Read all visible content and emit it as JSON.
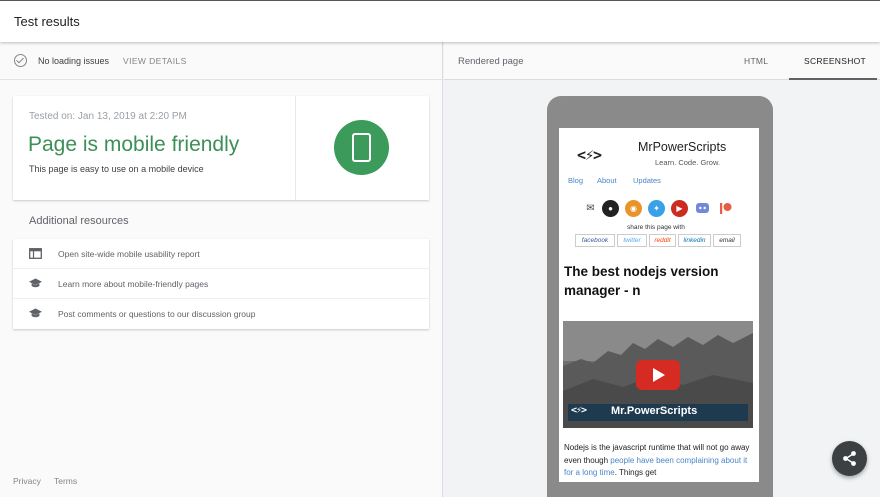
{
  "header": {
    "title": "Test results"
  },
  "status": {
    "text": "No loading issues",
    "view_details": "VIEW DETAILS"
  },
  "result": {
    "tested_on": "Tested on: Jan 13, 2019 at 2:20 PM",
    "headline": "Page is mobile friendly",
    "subline": "This page is easy to use on a mobile device",
    "accent_color": "#3c8f56"
  },
  "resources": {
    "heading": "Additional resources",
    "items": [
      {
        "label": "Open site-wide mobile usability report",
        "icon": "web-window-icon"
      },
      {
        "label": "Learn more about mobile-friendly pages",
        "icon": "school-icon"
      },
      {
        "label": "Post comments or questions to our discussion group",
        "icon": "school-icon"
      }
    ]
  },
  "footer": {
    "privacy": "Privacy",
    "terms": "Terms"
  },
  "preview": {
    "label": "Rendered page",
    "tabs": [
      {
        "label": "HTML",
        "active": false
      },
      {
        "label": "SCREENSHOT",
        "active": true
      }
    ]
  },
  "site": {
    "logo": "<⚡>",
    "brand": "MrPowerScripts",
    "tagline": "Learn. Code. Grow.",
    "nav": [
      "Blog",
      "About",
      "Updates"
    ],
    "social": [
      {
        "icon": "email-icon",
        "color": "#444444"
      },
      {
        "icon": "github-icon",
        "color": "#222222"
      },
      {
        "icon": "rss-icon",
        "color": "#e7942a"
      },
      {
        "icon": "twitter-icon",
        "color": "#3aa0e8"
      },
      {
        "icon": "youtube-icon",
        "color": "#cc2b22"
      },
      {
        "icon": "discord-icon",
        "color": "#7289da"
      },
      {
        "icon": "patreon-icon",
        "color": "#e85b46"
      }
    ],
    "share_label": "share this page with",
    "share_buttons": [
      {
        "label": "facebook",
        "color": "#3b5998"
      },
      {
        "label": "twitter",
        "color": "#55acee"
      },
      {
        "label": "reddit",
        "color": "#ff4500"
      },
      {
        "label": "linkedin",
        "color": "#0077b5"
      },
      {
        "label": "email",
        "color": "#333333"
      }
    ],
    "post_title": "The best nodejs version manager - n",
    "video_logo": "<⚡>",
    "video_title": "Mr.PowerScripts",
    "body_text_1": "Nodejs is the javascript runtime that will not go away even though ",
    "body_link": "people have been complaining about it for a long time",
    "body_text_2": ". Things get"
  }
}
